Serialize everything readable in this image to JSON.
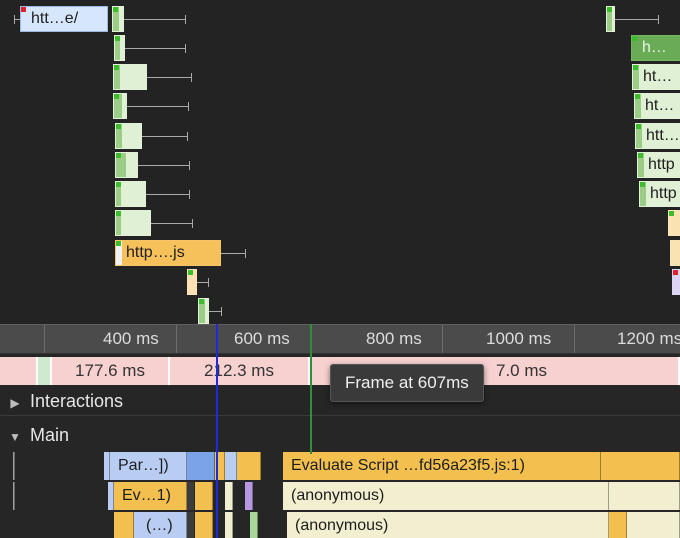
{
  "network": {
    "requests": [
      {
        "label": "htt…e/"
      },
      {
        "label": "http….js"
      },
      {
        "label": "h…"
      },
      {
        "label": "ht…"
      },
      {
        "label": "ht…"
      },
      {
        "label": "htt…"
      },
      {
        "label": "http"
      },
      {
        "label": "http"
      }
    ]
  },
  "ruler": {
    "ticks": [
      "400 ms",
      "600 ms",
      "800 ms",
      "1000 ms",
      "1200 ms"
    ]
  },
  "frames": {
    "items": [
      {
        "label": "177.6 ms"
      },
      {
        "label": "212.3 ms"
      },
      {
        "label": "7.0 ms"
      }
    ],
    "tooltip": "Frame at 607ms"
  },
  "tracks": {
    "interactions": "Interactions",
    "main": "Main"
  },
  "flame": {
    "row1": [
      "Par…])",
      "Evaluate Script …fd56a23f5.js:1)"
    ],
    "row2": [
      "Ev…1)",
      "(anonymous)"
    ],
    "row3": [
      "(…)",
      "(anonymous)"
    ]
  },
  "colors": {
    "scripting": "#f3c04f",
    "loading": "#7aa4e5",
    "frame": "#f7d0d0",
    "current_time": "#1e2bd8"
  }
}
